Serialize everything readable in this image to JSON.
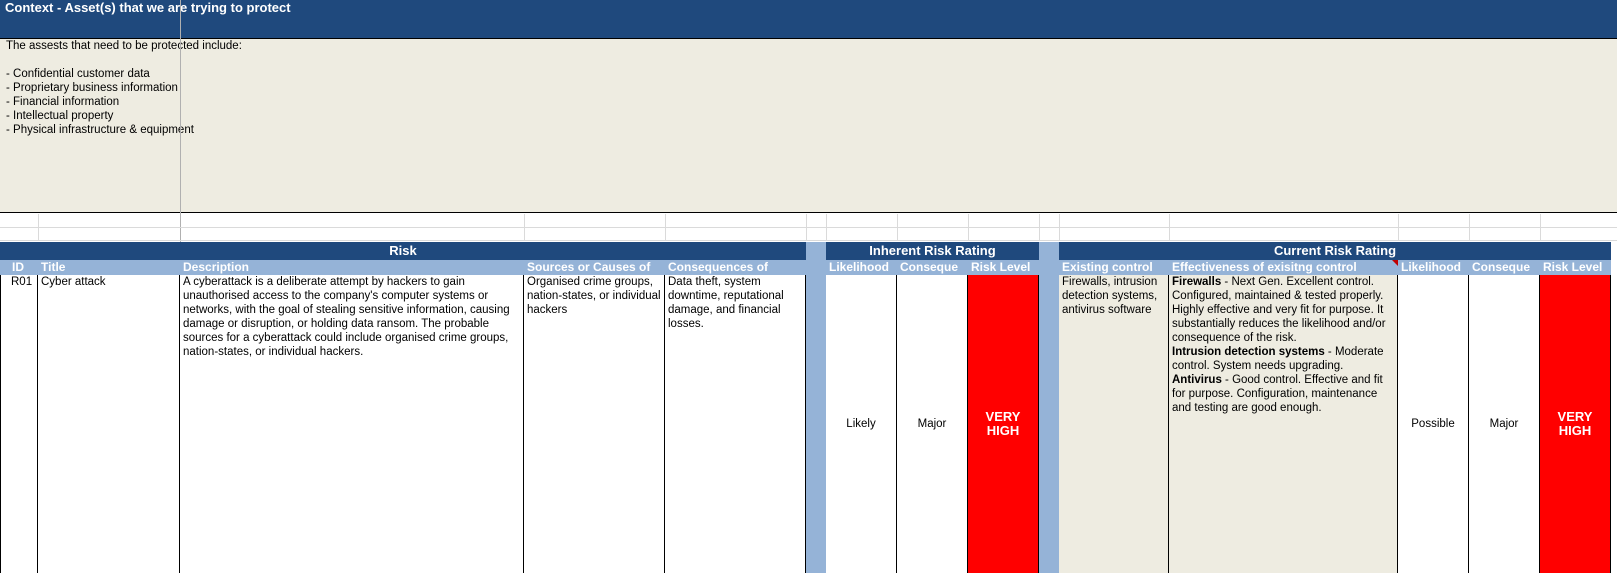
{
  "context": {
    "title": "Context - Asset(s) that we are trying to protect",
    "intro": "The assests that need to be protected include:",
    "assets": [
      "- Confidential customer data",
      "- Proprietary business information",
      "- Financial information",
      "- Intellectual property",
      "- Physical infrastructure & equipment"
    ]
  },
  "bands": {
    "risk": "Risk",
    "inherent": "Inherent Risk Rating",
    "current": "Current Risk Rating"
  },
  "columns": {
    "id": "ID",
    "title": "Title",
    "description": "Description",
    "sources": "Sources or Causes of",
    "consequences": "Consequences of",
    "inherent_likelihood": "Likelihood",
    "inherent_consequence": "Conseque",
    "inherent_level": "Risk Level",
    "existing_control": "Existing control",
    "effectiveness": "Effectiveness of exisitng control",
    "current_likelihood": "Likelihood",
    "current_consequence": "Conseque",
    "current_level": "Risk Level"
  },
  "row": {
    "id": "R01",
    "title": "Cyber attack",
    "description": "A cyberattack is a deliberate attempt by hackers to gain unauthorised access to the company's computer systems or networks, with the goal of stealing sensitive information, causing damage or disruption, or holding data ransom. The probable sources for a cyberattack could include organised crime groups, nation-states, or individual hackers.",
    "sources": "Organised crime groups, nation-states, or individual hackers",
    "consequences": "Data theft, system downtime, reputational damage, and financial losses.",
    "inherent_likelihood": "Likely",
    "inherent_consequence": "Major",
    "inherent_level": "VERY HIGH",
    "existing_control": "Firewalls, intrusion detection systems, antivirus software",
    "effectiveness": [
      {
        "label": "Firewalls",
        "text": " - Next Gen. Excellent control. Configured, maintained & tested properly. Highly effective and very fit for purpose. It substantially reduces the likelihood and/or consequence of the risk."
      },
      {
        "label": "Intrusion detection systems",
        "text": " - Moderate control. System needs upgrading."
      },
      {
        "label": "Antivirus",
        "text": " - Good control. Effective and fit for purpose. Configuration, maintenance and testing are good enough."
      }
    ],
    "current_likelihood": "Possible",
    "current_consequence": "Major",
    "current_level": "VERY HIGH"
  },
  "colors": {
    "header_blue": "#1f497d",
    "subheader_blue": "#95b3d7",
    "beige": "#eeece1",
    "very_high_red": "#ff0000"
  }
}
